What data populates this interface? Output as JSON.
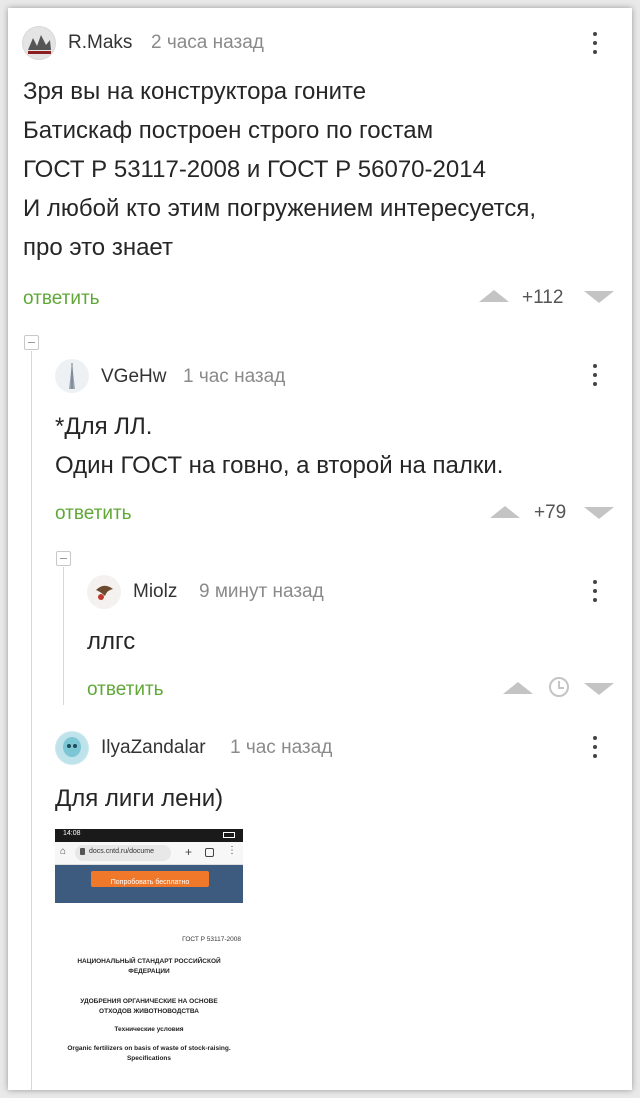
{
  "comments": [
    {
      "author": "R.Maks",
      "time": "2 часа назад",
      "lines": [
        "Зря вы на конструктора гоните",
        "Батискаф построен строго по гостам",
        "ГОСТ Р 53117-2008 и ГОСТ Р 56070-2014",
        "И любой кто этим погружением интересуется,",
        "про это знает"
      ],
      "reply_label": "ответить",
      "rating": "+112",
      "avatar_icon": "stamp-logo-icon"
    },
    {
      "author": "VGeHw",
      "time": "1 час назад",
      "lines": [
        "*Для ЛЛ.",
        "Один ГОСТ на говно, а второй на палки."
      ],
      "reply_label": "ответить",
      "rating": "+79",
      "avatar_icon": "tower-icon"
    },
    {
      "author": "Miolz",
      "time": "9 минут назад",
      "lines": [
        "ллгс"
      ],
      "reply_label": "ответить",
      "rating_icon": "clock-icon",
      "avatar_icon": "bird-icon"
    },
    {
      "author": "IlyaZandalar",
      "time": "1 час назад",
      "lines": [
        "Для лиги лени)"
      ],
      "avatar_icon": "ghost-avatar-icon"
    }
  ],
  "attachment": {
    "status_time": "14:08",
    "url": "docs.cntd.ru/docume",
    "cta_button": "Попробовать бесплатно",
    "doc_number": "ГОСТ Р 53117-2008",
    "standard_type": "НАЦИОНАЛЬНЫЙ СТАНДАРТ РОССИЙСКОЙ ФЕДЕРАЦИИ",
    "doc_title": "УДОБРЕНИЯ ОРГАНИЧЕСКИЕ НА ОСНОВЕ ОТХОДОВ ЖИВОТНОВОДСТВА",
    "doc_subtitle": "Технические условия",
    "doc_title_en": "Organic fertilizers on basis of waste of stock-raising. Specifications"
  },
  "colors": {
    "reply": "#5fa837",
    "vote": "#c4c4c4",
    "cta": "#f0782b",
    "header_bar": "#3d5b7e"
  }
}
